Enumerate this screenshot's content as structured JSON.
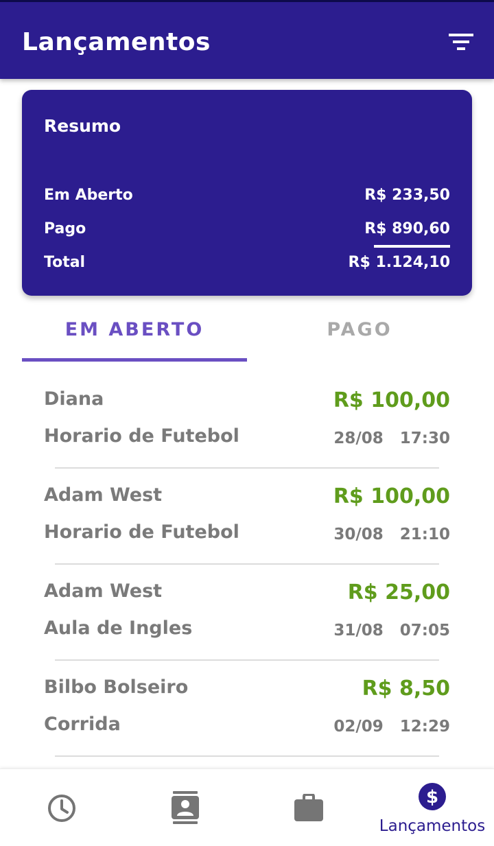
{
  "appbar": {
    "title": "Lançamentos",
    "filter_icon": "filter-icon"
  },
  "summary": {
    "title": "Resumo",
    "rows": [
      {
        "label": "Em Aberto",
        "value": "R$ 233,50"
      },
      {
        "label": "Pago",
        "value": "R$ 890,60"
      },
      {
        "label": "Total",
        "value": "R$ 1.124,10"
      }
    ]
  },
  "tabs": [
    {
      "label": "EM ABERTO",
      "selected": true
    },
    {
      "label": "PAGO",
      "selected": false
    }
  ],
  "entries": [
    {
      "name": "Diana",
      "description": "Horario de Futebol",
      "amount": "R$ 100,00",
      "date": "28/08",
      "time": "17:30"
    },
    {
      "name": "Adam West",
      "description": "Horario de Futebol",
      "amount": "R$ 100,00",
      "date": "30/08",
      "time": "21:10"
    },
    {
      "name": "Adam West",
      "description": "Aula de Ingles",
      "amount": "R$ 25,00",
      "date": "31/08",
      "time": "07:05"
    },
    {
      "name": "Bilbo Bolseiro",
      "description": "Corrida",
      "amount": "R$ 8,50",
      "date": "02/09",
      "time": "12:29"
    }
  ],
  "bottom_nav": {
    "items": [
      {
        "icon": "clock-icon",
        "label": ""
      },
      {
        "icon": "contacts-icon",
        "label": ""
      },
      {
        "icon": "briefcase-icon",
        "label": ""
      },
      {
        "icon": "dollar-icon",
        "label": "Lançamentos",
        "active": true
      }
    ]
  },
  "colors": {
    "primary": "#2c1d8f",
    "accent": "#6a4fc2",
    "amount": "#5f9c1c",
    "text_gray": "#7a7a7a",
    "inactive_icon": "#757575"
  }
}
